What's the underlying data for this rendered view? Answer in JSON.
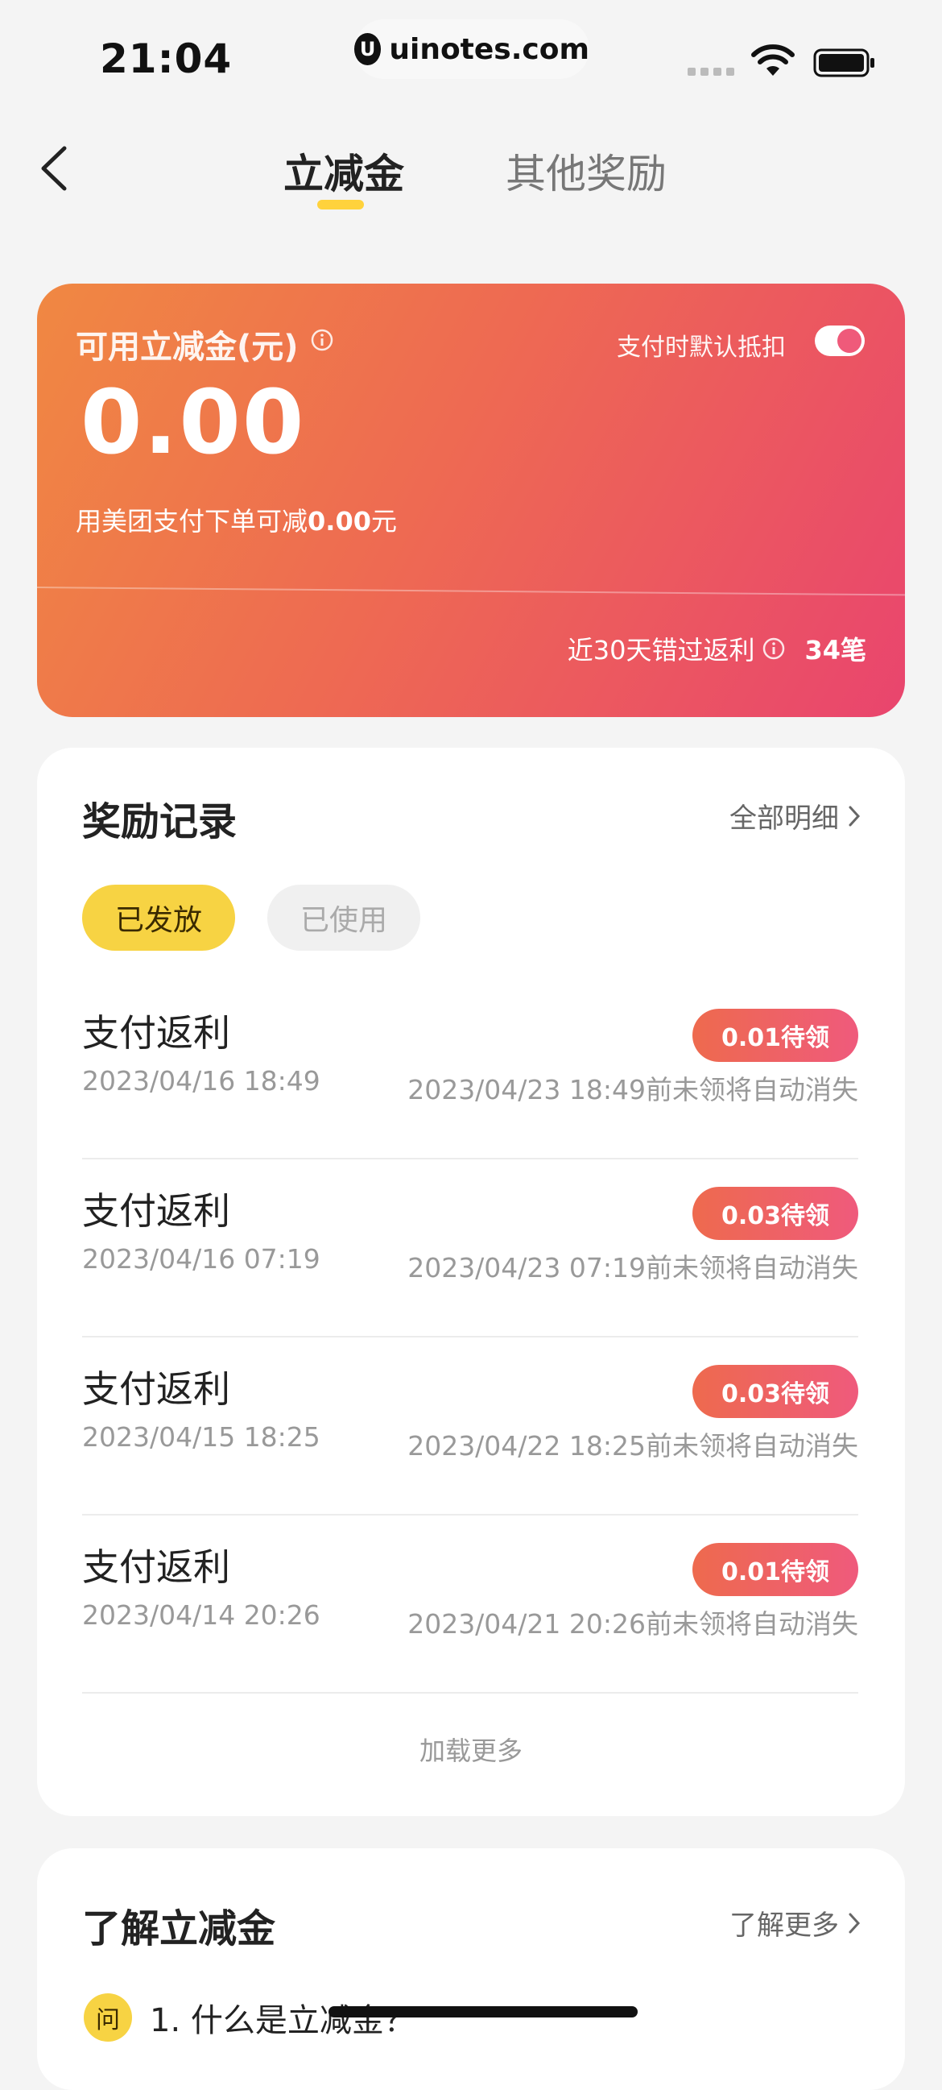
{
  "status_bar": {
    "time": "21:04",
    "url": "uinotes.com",
    "url_logo": "U"
  },
  "nav": {
    "tabs": [
      {
        "label": "立减金",
        "active": true
      },
      {
        "label": "其他奖励",
        "active": false
      }
    ]
  },
  "promo": {
    "title": "可用立减金(元)",
    "auto_deduct_label": "支付时默认抵扣",
    "auto_deduct_on": true,
    "balance": "0.00",
    "note_prefix": "用美团支付下单可减",
    "note_amount": "0.00",
    "note_suffix": "元",
    "missed_label": "近30天错过返利",
    "missed_count": "34笔"
  },
  "records": {
    "title": "奖励记录",
    "link": "全部明细",
    "filters": [
      {
        "label": "已发放",
        "selected": true
      },
      {
        "label": "已使用",
        "selected": false
      }
    ],
    "items": [
      {
        "name": "支付返利",
        "time": "2023/04/16 18:49",
        "badge": "0.01待领",
        "expire": "2023/04/23 18:49前未领将自动消失"
      },
      {
        "name": "支付返利",
        "time": "2023/04/16 07:19",
        "badge": "0.03待领",
        "expire": "2023/04/23 07:19前未领将自动消失"
      },
      {
        "name": "支付返利",
        "time": "2023/04/15 18:25",
        "badge": "0.03待领",
        "expire": "2023/04/22 18:25前未领将自动消失"
      },
      {
        "name": "支付返利",
        "time": "2023/04/14 20:26",
        "badge": "0.01待领",
        "expire": "2023/04/21 20:26前未领将自动消失"
      }
    ],
    "load_more": "加载更多"
  },
  "learn": {
    "title": "了解立减金",
    "link": "了解更多",
    "faq": [
      {
        "badge": "问",
        "text": "1. 什么是立减金？"
      }
    ]
  },
  "colors": {
    "accent_yellow": "#f7d343",
    "card_gradient_start": "#f08842",
    "card_gradient_end": "#e9456e"
  }
}
